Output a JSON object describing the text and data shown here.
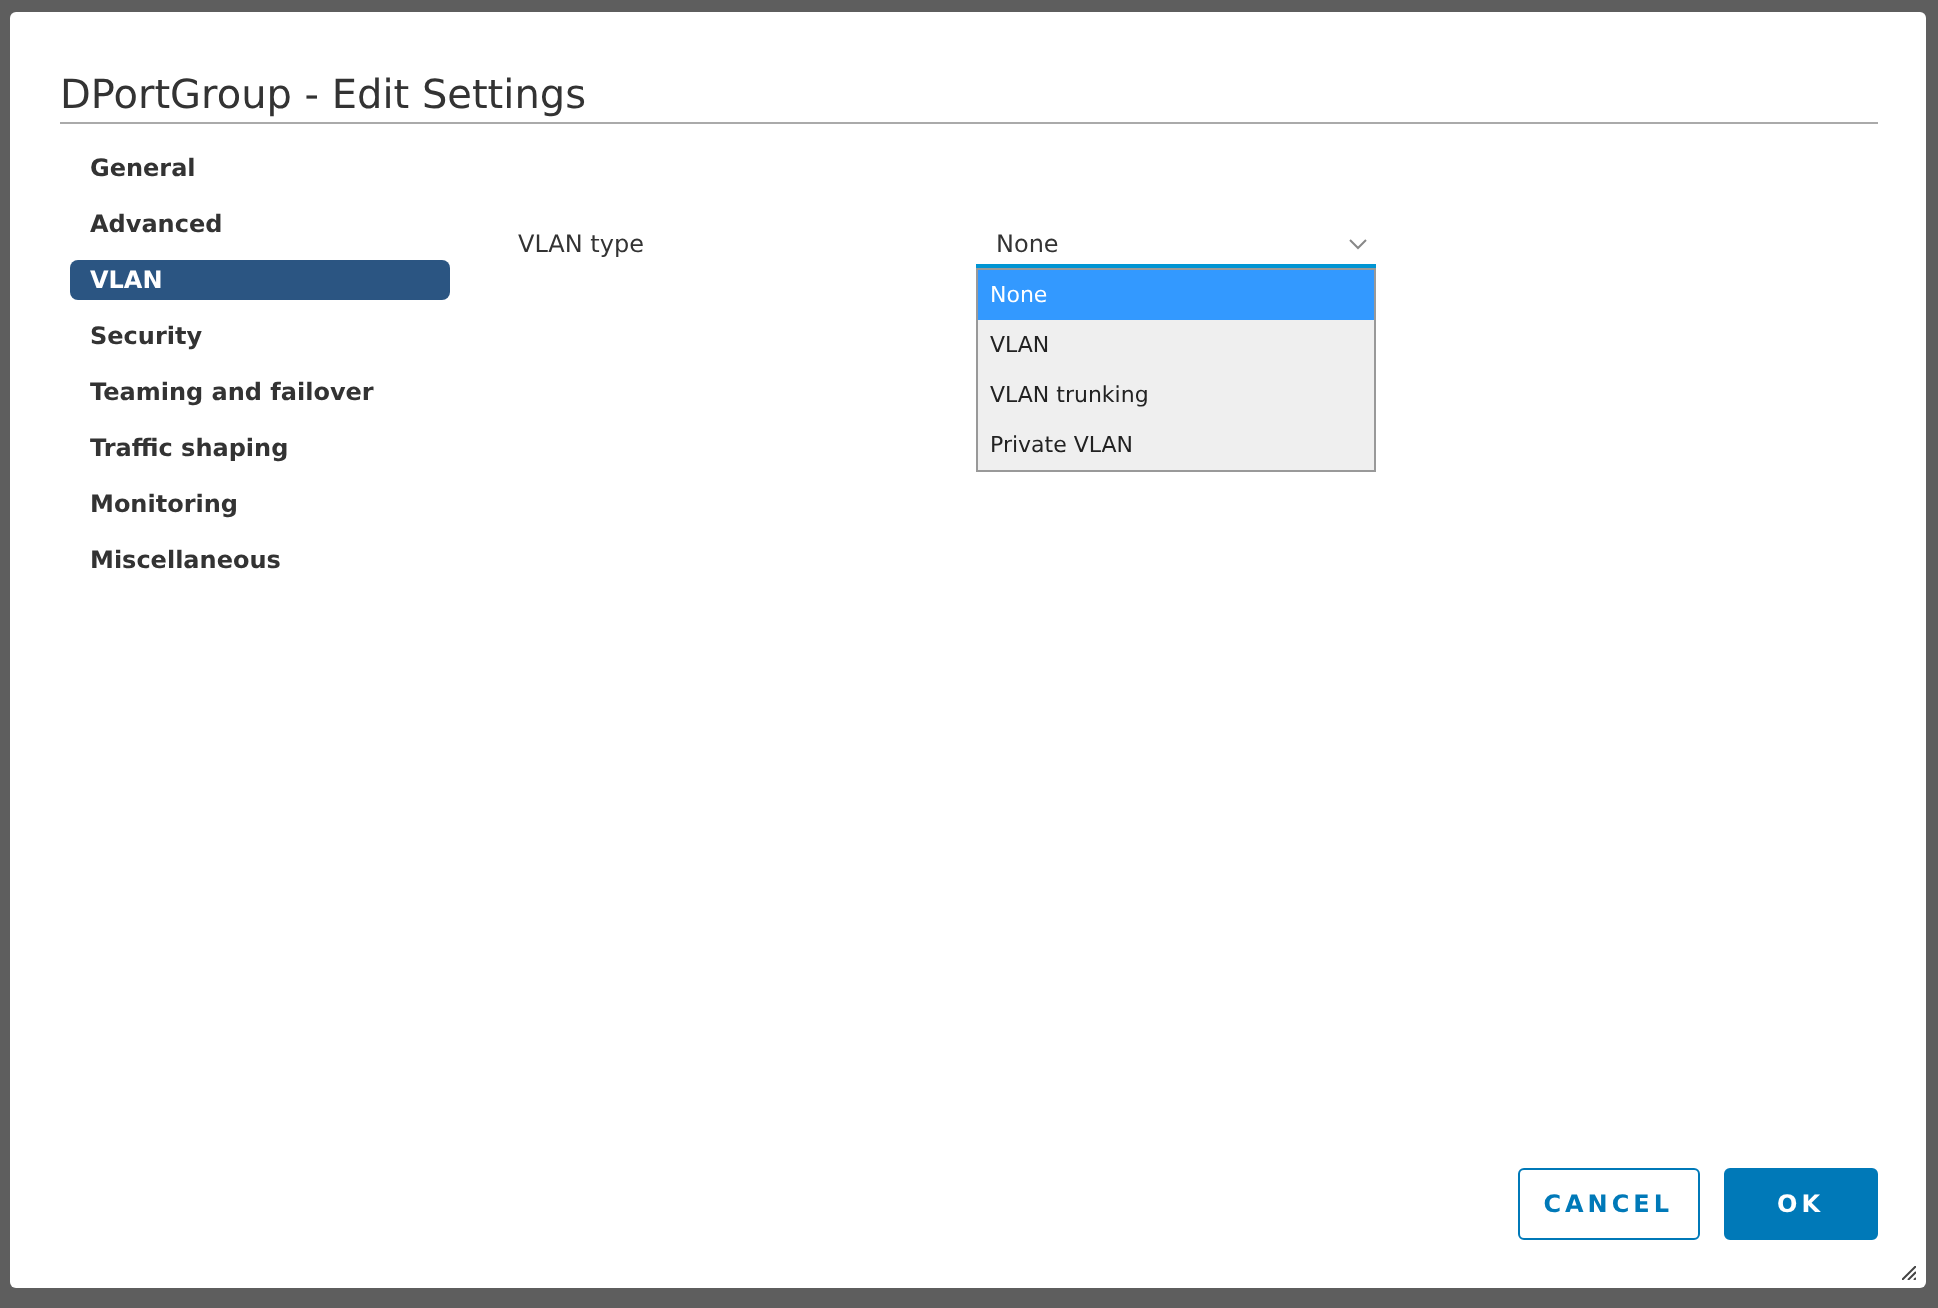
{
  "dialog": {
    "title": "DPortGroup - Edit Settings"
  },
  "sidebar": {
    "items": [
      {
        "label": "General",
        "selected": false
      },
      {
        "label": "Advanced",
        "selected": false
      },
      {
        "label": "VLAN",
        "selected": true
      },
      {
        "label": "Security",
        "selected": false
      },
      {
        "label": "Teaming and failover",
        "selected": false
      },
      {
        "label": "Traffic shaping",
        "selected": false
      },
      {
        "label": "Monitoring",
        "selected": false
      },
      {
        "label": "Miscellaneous",
        "selected": false
      }
    ]
  },
  "field": {
    "label": "VLAN type",
    "value": "None",
    "expanded": true,
    "options": [
      {
        "label": "None",
        "selected": true
      },
      {
        "label": "VLAN",
        "selected": false
      },
      {
        "label": "VLAN trunking",
        "selected": false
      },
      {
        "label": "Private VLAN",
        "selected": false
      }
    ]
  },
  "buttons": [
    {
      "label": "CANCEL",
      "kind": "secondary"
    },
    {
      "label": "OK",
      "kind": "primary"
    }
  ]
}
